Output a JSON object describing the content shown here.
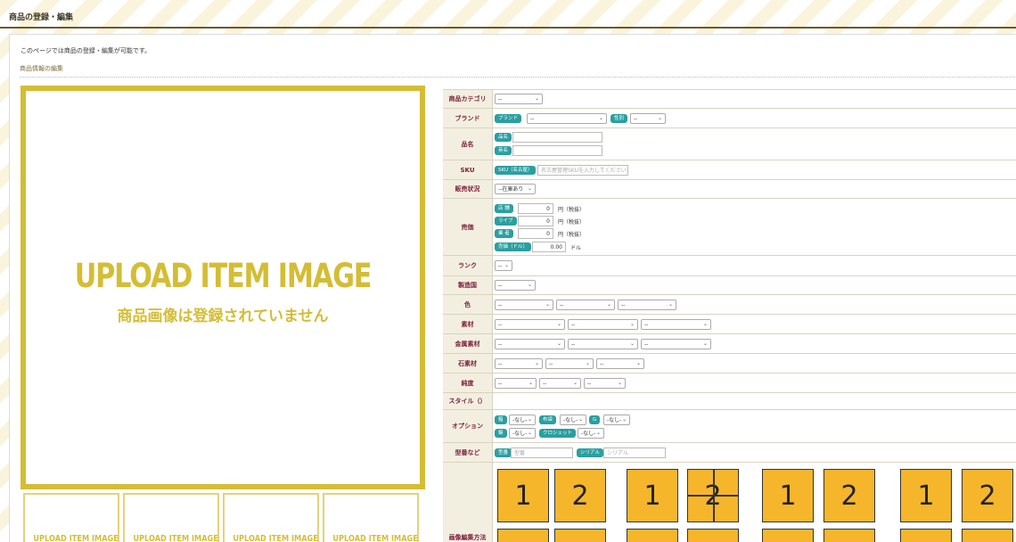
{
  "header": {
    "title": "商品の登録・編集"
  },
  "intro": "このページでは商品の登録・編集が可能です。",
  "section_title": "商品情報の編集",
  "main_image": {
    "text_en": "UPLOAD ITEM IMAGE",
    "text_jp": "商品画像は登録されていません"
  },
  "thumbnails": [
    "UPLOAD ITEM IMAGE",
    "UPLOAD ITEM IMAGE",
    "UPLOAD ITEM IMAGE",
    "UPLOAD ITEM IMAGE"
  ],
  "form": {
    "category": {
      "label": "商品カテゴリ",
      "value": "--"
    },
    "brand": {
      "label": "ブランド",
      "tag": "ブランド",
      "value": "--",
      "gender_tag": "性別",
      "gender_value": "--"
    },
    "name": {
      "label": "品名",
      "tag1": "品名",
      "tag2": "英名"
    },
    "sku": {
      "label": "SKU",
      "tag": "SKU（名古屋）",
      "placeholder": "名古屋管理SKUを入力してください"
    },
    "status": {
      "label": "販売状況",
      "value": "--在庫あり"
    },
    "price": {
      "label": "売価",
      "rows": [
        {
          "tag": "店 舗",
          "value": "0",
          "unit": "円（税抜）"
        },
        {
          "tag": "ライブ",
          "value": "0",
          "unit": "円（税抜）"
        },
        {
          "tag": "業 者",
          "value": "0",
          "unit": "円（税抜）"
        },
        {
          "tag": "売価（ドル）",
          "value": "0.00",
          "unit": "ドル"
        }
      ]
    },
    "rank": {
      "label": "ランク",
      "value": "--"
    },
    "origin": {
      "label": "製造国",
      "value": "--"
    },
    "color": {
      "label": "色",
      "values": [
        "--",
        "--",
        "--"
      ]
    },
    "material": {
      "label": "素材",
      "values": [
        "--",
        "--",
        "--"
      ]
    },
    "metal": {
      "label": "金属素材",
      "values": [
        "--",
        "--",
        "--"
      ]
    },
    "stone": {
      "label": "石素材",
      "values": [
        "--",
        "--",
        "--"
      ]
    },
    "purity": {
      "label": "純度",
      "values": [
        "--",
        "--",
        "--"
      ]
    },
    "style": {
      "label": "スタイル（）"
    },
    "options": {
      "label": "オプション",
      "row1": [
        {
          "tag": "箱",
          "value": "-なし-"
        },
        {
          "tag": "布袋",
          "value": "-なし-"
        },
        {
          "tag": "G",
          "value": "-なし-"
        }
      ],
      "row2": [
        {
          "tag": "鍵",
          "value": "-なし-"
        },
        {
          "tag": "クロシェット",
          "value": "-なし-"
        }
      ]
    },
    "model": {
      "label": "型番など",
      "tag1": "型番",
      "placeholder1": "型番",
      "tag2": "シリアル",
      "placeholder2": "シリアル"
    },
    "image_edit": {
      "label": "画像編集方法",
      "tiles": [
        "1",
        "2",
        "1",
        "2",
        "1",
        "2",
        "1",
        "2"
      ]
    }
  },
  "colors": {
    "accent": "#d4bd35",
    "tag": "#2a9fa0",
    "label_text": "#7a1d3a",
    "tile": "#f6b62c"
  }
}
